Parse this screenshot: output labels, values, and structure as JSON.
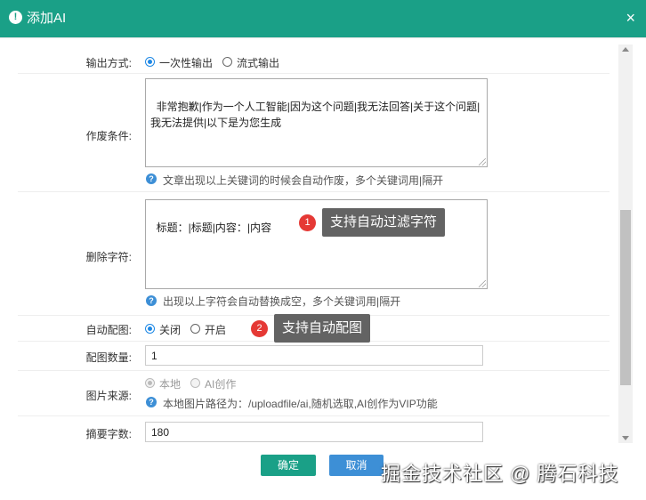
{
  "dialog": {
    "title": "添加AI",
    "close": "×"
  },
  "output_mode": {
    "label": "输出方式:",
    "options": [
      "一次性输出",
      "流式输出"
    ],
    "selected": "一次性输出"
  },
  "void_condition": {
    "label": "作废条件:",
    "value": "非常抱歉|作为一个人工智能|因为这个问题|我无法回答|关于这个问题|我无法提供|以下是为您生成",
    "help": "文章出现以上关键词的时候会自动作废，多个关键词用|隔开"
  },
  "delete_chars": {
    "label": "删除字符:",
    "value": "标题：|标题|内容：|内容",
    "help": "出现以上字符会自动替换成空，多个关键词用|隔开"
  },
  "auto_image": {
    "label": "自动配图:",
    "options": [
      "关闭",
      "开启"
    ],
    "selected": "关闭"
  },
  "image_count": {
    "label": "配图数量:",
    "value": "1"
  },
  "image_source": {
    "label": "图片来源:",
    "options": [
      "本地",
      "AI创作"
    ],
    "selected": "本地",
    "help": "本地图片路径为：/uploadfile/ai,随机选取,AI创作为VIP功能"
  },
  "summary_chars": {
    "label": "摘要字数:",
    "value": "180"
  },
  "annotations": [
    {
      "number": "1",
      "text": "支持自动过滤字符"
    },
    {
      "number": "2",
      "text": "支持自动配图"
    }
  ],
  "footer": {
    "confirm": "确定",
    "cancel": "取消"
  },
  "watermark": "掘金技术社区 @ 腾石科技",
  "colors": {
    "header": "#1aa087",
    "confirm": "#1aa087",
    "cancel": "#3d8fd6",
    "badge": "#e53935",
    "tooltip": "#636363"
  }
}
